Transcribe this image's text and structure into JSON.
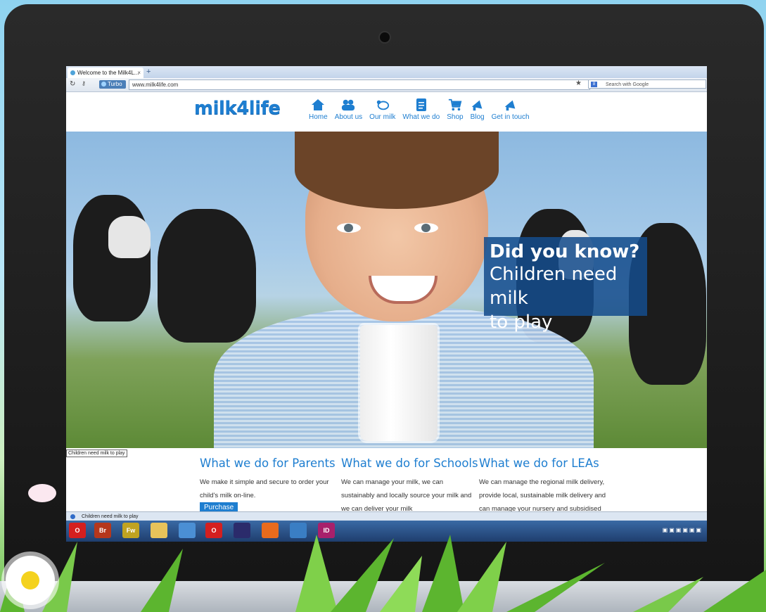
{
  "browser": {
    "tab_title": "Welcome to the Milk4L...",
    "tab_close": "×",
    "new_tab": "+",
    "turbo_label": "Turbo",
    "url": "www.milk4life.com",
    "search_placeholder": "Search with Google"
  },
  "site": {
    "logo": "milk4life",
    "nav": [
      {
        "label": "Home",
        "icon": "home-icon"
      },
      {
        "label": "About us",
        "icon": "people-icon"
      },
      {
        "label": "Our milk",
        "icon": "cow-icon"
      },
      {
        "label": "What we do",
        "icon": "document-icon"
      },
      {
        "label": "Shop",
        "icon": "cart-icon"
      },
      {
        "label": "Blog",
        "icon": "megaphone-icon"
      },
      {
        "label": "Get in touch",
        "icon": "megaphone-icon"
      }
    ]
  },
  "hero": {
    "headline_bold": "Did you know?",
    "headline_line2": "Children need milk",
    "headline_line3": "to play"
  },
  "tooltip": "Children need milk to play",
  "columns": [
    {
      "title": "What we do for Parents",
      "text": "We make it simple and secure to order your child's milk on-line.",
      "button": "Purchase"
    },
    {
      "title": "What we do for Schools",
      "text": "We can manage your milk, we can sustainably and locally source your milk and we can deliver your milk"
    },
    {
      "title": "What we do for LEAs",
      "text": "We can manage the regional milk delivery, provide local, sustainable milk delivery and can manage your nursery and subsidised"
    }
  ],
  "status_bar": "Children need milk to play",
  "taskbar": {
    "items": [
      {
        "label": "O",
        "color": "#d41f1f"
      },
      {
        "label": "Br",
        "color": "#b5371c"
      },
      {
        "label": "Fw",
        "color": "#c0a321"
      },
      {
        "label": "",
        "color": "#e8c35a"
      },
      {
        "label": "",
        "color": "#4b8fd4"
      },
      {
        "label": "O",
        "color": "#d41f1f"
      },
      {
        "label": "",
        "color": "#2b2b6b"
      },
      {
        "label": "",
        "color": "#e86b1d"
      },
      {
        "label": "",
        "color": "#3a7ec4"
      },
      {
        "label": "ID",
        "color": "#a8206b"
      }
    ]
  },
  "colors": {
    "brand": "#1e7ed0",
    "overlay": "#144c8c"
  }
}
